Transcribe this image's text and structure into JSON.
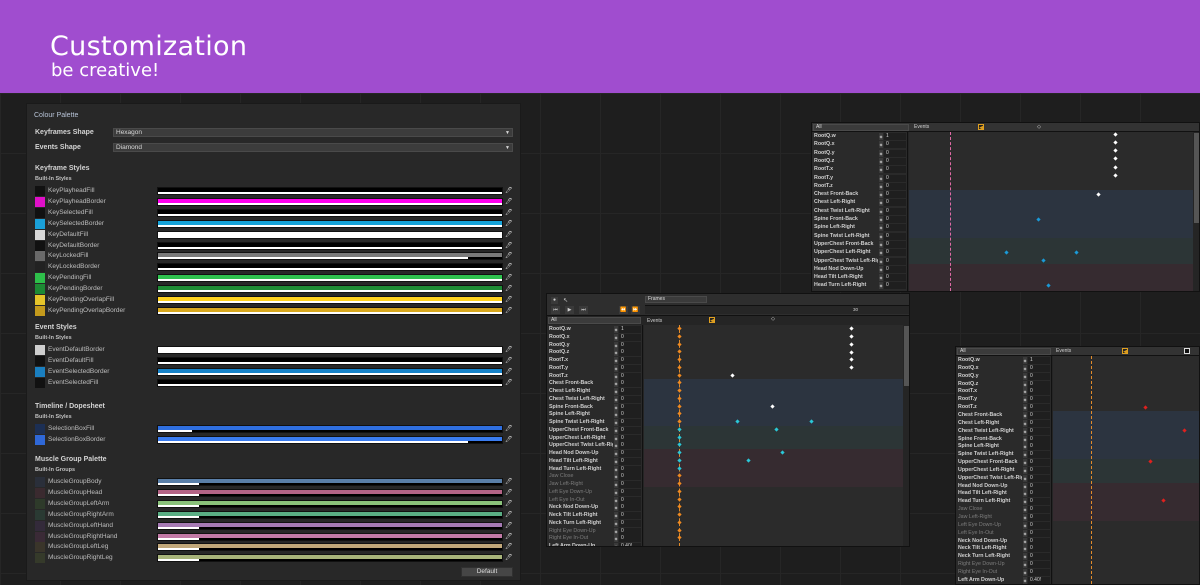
{
  "banner": {
    "title": "Customization",
    "subtitle": "be creative!",
    "color": "#a04dcf"
  },
  "palette": {
    "title": "Colour Palette",
    "keyframes_shape_label": "Keyframes Shape",
    "keyframes_shape_value": "Hexagon",
    "events_shape_label": "Events Shape",
    "events_shape_value": "Diamond",
    "keyframe_styles": {
      "heading": "Keyframe Styles",
      "sub": "Built-In Styles",
      "items": [
        {
          "label": "KeyPlayheadFill",
          "swatch": "#111111",
          "bar": "#000000"
        },
        {
          "label": "KeyPlayheadBorder",
          "swatch": "#e010c8",
          "bar": "#ff00ee"
        },
        {
          "label": "KeySelectedFill",
          "swatch": "#111111",
          "bar": "#000000"
        },
        {
          "label": "KeySelectedBorder",
          "swatch": "#1aa0d8",
          "bar": "#16a3d9"
        },
        {
          "label": "KeyDefaultFill",
          "swatch": "#d8d8d8",
          "bar": "#ffffff"
        },
        {
          "label": "KeyDefaultBorder",
          "swatch": "#111111",
          "bar": "#000000"
        },
        {
          "label": "KeyLockedFill",
          "swatch": "#6a6a6a",
          "bar": "#7a7a7a"
        },
        {
          "label": "KeyLockedBorder",
          "swatch": "#222222",
          "bar": "#000000"
        },
        {
          "label": "KeyPendingFill",
          "swatch": "#2ebf4a",
          "bar": "#2ec24e"
        },
        {
          "label": "KeyPendingBorder",
          "swatch": "#1d8a34",
          "bar": "#1e8c35"
        },
        {
          "label": "KeyPendingOverlapFill",
          "swatch": "#e6c52a",
          "bar": "#ffd21e"
        },
        {
          "label": "KeyPendingOverlapBorder",
          "swatch": "#c49a1c",
          "bar": "#d8a81e"
        }
      ]
    },
    "event_styles": {
      "heading": "Event Styles",
      "sub": "Built-In Styles",
      "items": [
        {
          "label": "EventDefaultBorder",
          "swatch": "#cfcfcf",
          "bar": "#ffffff"
        },
        {
          "label": "EventDefaultFill",
          "swatch": "#111111",
          "bar": "#000000"
        },
        {
          "label": "EventSelectedBorder",
          "swatch": "#1a7fc0",
          "bar": "#1682c8"
        },
        {
          "label": "EventSelectedFill",
          "swatch": "#111111",
          "bar": "#000000"
        }
      ]
    },
    "timeline_styles": {
      "heading": "Timeline / Dopesheet",
      "sub": "Built-In Styles",
      "items": [
        {
          "label": "SelectionBoxFill",
          "swatch": "#1c2f54",
          "bar": "#2f6fe0"
        },
        {
          "label": "SelectionBoxBorder",
          "swatch": "#2f68d8",
          "bar": "#3a7cf0"
        }
      ]
    },
    "muscle_palette": {
      "heading": "Muscle Group Palette",
      "sub": "Built-In Groups",
      "items": [
        {
          "label": "MuscleGroupBody",
          "swatch": "#2a2f3a",
          "bar": "#5a7fa8"
        },
        {
          "label": "MuscleGroupHead",
          "swatch": "#3a2a2f",
          "bar": "#b46486"
        },
        {
          "label": "MuscleGroupLeftArm",
          "swatch": "#2e3a2a",
          "bar": "#8ac27a"
        },
        {
          "label": "MuscleGroupRightArm",
          "swatch": "#2a3a33",
          "bar": "#5aae84"
        },
        {
          "label": "MuscleGroupLeftHand",
          "swatch": "#332a3a",
          "bar": "#a67ab4"
        },
        {
          "label": "MuscleGroupRightHand",
          "swatch": "#3a2a36",
          "bar": "#c27aa6"
        },
        {
          "label": "MuscleGroupLeftLeg",
          "swatch": "#3a352a",
          "bar": "#c2a87a"
        },
        {
          "label": "MuscleGroupRightLeg",
          "swatch": "#353a2a",
          "bar": "#a8b47a"
        }
      ]
    },
    "default_button": "Default"
  },
  "dopesheet_center": {
    "frames_dropdown": "Frames",
    "filter_value": "All",
    "events_label": "Events",
    "ruler_mark": "30",
    "tracks": [
      {
        "label": "RootQ.w",
        "value": "1",
        "dim": false
      },
      {
        "label": "RootQ.x",
        "value": "0",
        "dim": false
      },
      {
        "label": "RootQ.y",
        "value": "0",
        "dim": false
      },
      {
        "label": "RootQ.z",
        "value": "0",
        "dim": false
      },
      {
        "label": "RootT.x",
        "value": "0",
        "dim": false
      },
      {
        "label": "RootT.y",
        "value": "0",
        "dim": false
      },
      {
        "label": "RootT.z",
        "value": "0",
        "dim": false
      },
      {
        "label": "Chest Front-Back",
        "value": "0",
        "dim": false
      },
      {
        "label": "Chest Left-Right",
        "value": "0",
        "dim": false
      },
      {
        "label": "Chest Twist Left-Right",
        "value": "0",
        "dim": false
      },
      {
        "label": "Spine Front-Back",
        "value": "0",
        "dim": false
      },
      {
        "label": "Spine Left-Right",
        "value": "0",
        "dim": false
      },
      {
        "label": "Spine Twist Left-Right",
        "value": "0",
        "dim": false
      },
      {
        "label": "UpperChest Front-Back",
        "value": "0",
        "dim": false
      },
      {
        "label": "UpperChest Left-Right",
        "value": "0",
        "dim": false
      },
      {
        "label": "UpperChest Twist Left-Right",
        "value": "0",
        "dim": false
      },
      {
        "label": "Head Nod Down-Up",
        "value": "0",
        "dim": false
      },
      {
        "label": "Head Tilt Left-Right",
        "value": "0",
        "dim": false
      },
      {
        "label": "Head Turn Left-Right",
        "value": "0",
        "dim": false
      },
      {
        "label": "Jaw Close",
        "value": "0",
        "dim": true
      },
      {
        "label": "Jaw Left-Right",
        "value": "0",
        "dim": true
      },
      {
        "label": "Left Eye Down-Up",
        "value": "0",
        "dim": true
      },
      {
        "label": "Left Eye In-Out",
        "value": "0",
        "dim": true
      },
      {
        "label": "Neck Nod Down-Up",
        "value": "0",
        "dim": false
      },
      {
        "label": "Neck Tilt Left-Right",
        "value": "0",
        "dim": false
      },
      {
        "label": "Neck Turn Left-Right",
        "value": "0",
        "dim": false
      },
      {
        "label": "Right Eye Down-Up",
        "value": "0",
        "dim": true
      },
      {
        "label": "Right Eye In-Out",
        "value": "0",
        "dim": true
      },
      {
        "label": "Left Arm Down-Up",
        "value": "0.40!",
        "dim": false
      }
    ]
  },
  "dopesheet_top": {
    "filter_value": "All",
    "events_label": "Events",
    "tracks": [
      {
        "label": "RootQ.w",
        "value": "1"
      },
      {
        "label": "RootQ.x",
        "value": "0"
      },
      {
        "label": "RootQ.y",
        "value": "0"
      },
      {
        "label": "RootQ.z",
        "value": "0"
      },
      {
        "label": "RootT.x",
        "value": "0"
      },
      {
        "label": "RootT.y",
        "value": "0"
      },
      {
        "label": "RootT.z",
        "value": "0"
      },
      {
        "label": "Chest Front-Back",
        "value": "0"
      },
      {
        "label": "Chest Left-Right",
        "value": "0"
      },
      {
        "label": "Chest Twist Left-Right",
        "value": "0"
      },
      {
        "label": "Spine Front-Back",
        "value": "0"
      },
      {
        "label": "Spine Left-Right",
        "value": "0"
      },
      {
        "label": "Spine Twist Left-Right",
        "value": "0"
      },
      {
        "label": "UpperChest Front-Back",
        "value": "0"
      },
      {
        "label": "UpperChest Left-Right",
        "value": "0"
      },
      {
        "label": "UpperChest Twist Left-Righ",
        "value": "0"
      },
      {
        "label": "Head Nod Down-Up",
        "value": "0"
      },
      {
        "label": "Head Tilt Left-Right",
        "value": "0"
      },
      {
        "label": "Head Turn Left-Right",
        "value": "0"
      }
    ]
  },
  "dopesheet_right": {
    "filter_value": "All",
    "events_label": "Events",
    "tracks": [
      {
        "label": "RootQ.w",
        "value": "1",
        "dim": false
      },
      {
        "label": "RootQ.x",
        "value": "0",
        "dim": false
      },
      {
        "label": "RootQ.y",
        "value": "0",
        "dim": false
      },
      {
        "label": "RootQ.z",
        "value": "0",
        "dim": false
      },
      {
        "label": "RootT.x",
        "value": "0",
        "dim": false
      },
      {
        "label": "RootT.y",
        "value": "0",
        "dim": false
      },
      {
        "label": "RootT.z",
        "value": "0",
        "dim": false
      },
      {
        "label": "Chest Front-Back",
        "value": "0",
        "dim": false
      },
      {
        "label": "Chest Left-Right",
        "value": "0",
        "dim": false
      },
      {
        "label": "Chest Twist Left-Right",
        "value": "0",
        "dim": false
      },
      {
        "label": "Spine Front-Back",
        "value": "0",
        "dim": false
      },
      {
        "label": "Spine Left-Right",
        "value": "0",
        "dim": false
      },
      {
        "label": "Spine Twist Left-Right",
        "value": "0",
        "dim": false
      },
      {
        "label": "UpperChest Front-Back",
        "value": "0",
        "dim": false
      },
      {
        "label": "UpperChest Left-Right",
        "value": "0",
        "dim": false
      },
      {
        "label": "UpperChest Twist Left-Right",
        "value": "0",
        "dim": false
      },
      {
        "label": "Head Nod Down-Up",
        "value": "0",
        "dim": false
      },
      {
        "label": "Head Tilt Left-Right",
        "value": "0",
        "dim": false
      },
      {
        "label": "Head Turn Left-Right",
        "value": "0",
        "dim": false
      },
      {
        "label": "Jaw Close",
        "value": "0",
        "dim": true
      },
      {
        "label": "Jaw Left-Right",
        "value": "0",
        "dim": true
      },
      {
        "label": "Left Eye Down-Up",
        "value": "0",
        "dim": true
      },
      {
        "label": "Left Eye In-Out",
        "value": "0",
        "dim": true
      },
      {
        "label": "Neck Nod Down-Up",
        "value": "0",
        "dim": false
      },
      {
        "label": "Neck Tilt Left-Right",
        "value": "0",
        "dim": false
      },
      {
        "label": "Neck Turn Left-Right",
        "value": "0",
        "dim": false
      },
      {
        "label": "Right Eye Down-Up",
        "value": "0",
        "dim": true
      },
      {
        "label": "Right Eye In-Out",
        "value": "0",
        "dim": true
      },
      {
        "label": "Left Arm Down-Up",
        "value": "0.40!",
        "dim": false
      }
    ]
  }
}
